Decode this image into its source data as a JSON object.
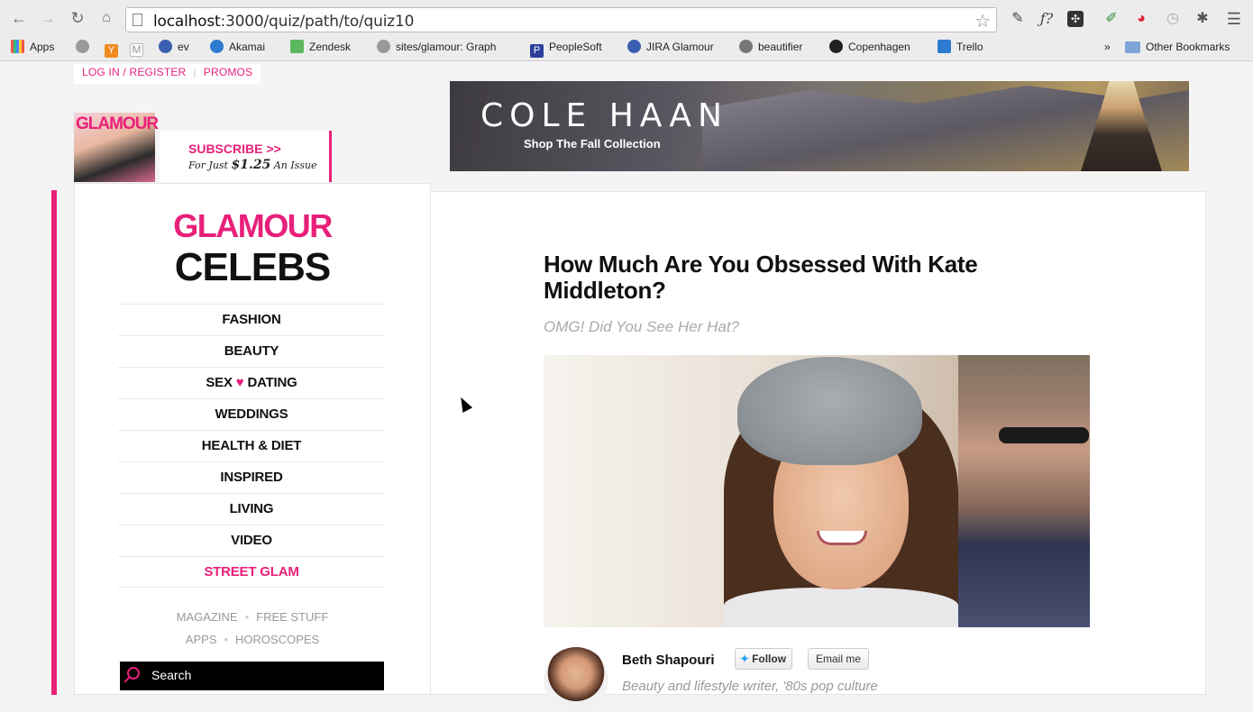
{
  "browser": {
    "url_host": "localhost",
    "url_rest": ":3000/quiz/path/to/quiz10",
    "bookmarks": [
      {
        "label": "Apps",
        "color": "#e54"
      },
      {
        "label": "",
        "color": "#888"
      },
      {
        "label": "",
        "color": "#f08a20"
      },
      {
        "label": "",
        "color": "#bbb"
      },
      {
        "label": "ev",
        "color": "#3a5fb0"
      },
      {
        "label": "Akamai",
        "color": "#2d7ad0"
      },
      {
        "label": "Zendesk",
        "color": "#5cb85c"
      },
      {
        "label": "sites/glamour: Graph",
        "color": "#999"
      },
      {
        "label": "PeopleSoft",
        "color": "#2a3f9a"
      },
      {
        "label": "JIRA Glamour",
        "color": "#3a5fb0"
      },
      {
        "label": "beautifier",
        "color": "#777"
      },
      {
        "label": "Copenhagen",
        "color": "#222"
      },
      {
        "label": "Trello",
        "color": "#2d7ad0"
      }
    ],
    "overflow": "»",
    "other_bookmarks": "Other Bookmarks"
  },
  "header": {
    "login": "LOG IN / REGISTER",
    "promos": "PROMOS",
    "subscribe": "SUBSCRIBE >>",
    "price_prefix": "For Just ",
    "price": "$1.25",
    "price_suffix": " An Issue",
    "cover_text": "GLAMOUR"
  },
  "ad": {
    "brand": "COLE HAAN",
    "tagline": "Shop The Fall Collection"
  },
  "sidebar": {
    "logo_top": "GLAMOUR",
    "logo_bottom": "CELEBS",
    "nav": [
      "FASHION",
      "BEAUTY",
      "SEX",
      "DATING",
      "WEDDINGS",
      "HEALTH & DIET",
      "INSPIRED",
      "LIVING",
      "VIDEO",
      "STREET GLAM"
    ],
    "heart": "♥",
    "subnav": [
      "MAGAZINE",
      "FREE STUFF",
      "APPS",
      "HOROSCOPES"
    ],
    "bullet": "•",
    "search_label": "Search"
  },
  "article": {
    "title": "How Much Are You Obsessed With Kate Middleton?",
    "subtitle": "OMG! Did You See Her Hat?",
    "author": "Beth Shapouri",
    "follow": "Follow",
    "email": "Email me",
    "bio": "Beauty and lifestyle writer, '80s pop culture"
  }
}
